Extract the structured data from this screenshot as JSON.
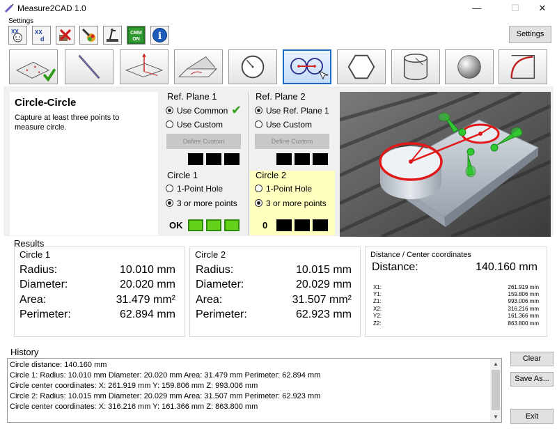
{
  "window": {
    "title": "Measure2CAD 1.0",
    "minimize": "—",
    "maximize": "☐",
    "close": "✕"
  },
  "toolbar": {
    "group_label": "Settings",
    "settings_button": "Settings",
    "cmm_label_top": "CMM",
    "cmm_label_bottom": "ON",
    "info_glyph": "i"
  },
  "description": {
    "title": "Circle-Circle",
    "text": "Capture at least three points to measure circle."
  },
  "ref_plane_1": {
    "title": "Ref. Plane 1",
    "options": [
      "Use Common",
      "Use Custom"
    ],
    "selected": 0,
    "define_label": "Define Custom",
    "status_check": "✔"
  },
  "ref_plane_2": {
    "title": "Ref. Plane 2",
    "options": [
      "Use Ref. Plane 1",
      "Use Custom"
    ],
    "selected": 0,
    "define_label": "Define Custom"
  },
  "circle_1": {
    "title": "Circle 1",
    "options": [
      "1-Point Hole",
      "3 or more points"
    ],
    "selected": 1,
    "status": "OK",
    "indicator_color": "#64d21a"
  },
  "circle_2": {
    "title": "Circle 2",
    "options": [
      "1-Point Hole",
      "3 or more points"
    ],
    "selected": 1,
    "status": "0",
    "highlight_color": "#ffffc0"
  },
  "results": {
    "label": "Results",
    "circle1": {
      "title": "Circle 1",
      "rows": [
        {
          "label": "Radius:",
          "value": "10.010 mm"
        },
        {
          "label": "Diameter:",
          "value": "20.020 mm"
        },
        {
          "label": "Area:",
          "value": "31.479 mm²"
        },
        {
          "label": "Perimeter:",
          "value": "62.894 mm"
        }
      ]
    },
    "circle2": {
      "title": "Circle 2",
      "rows": [
        {
          "label": "Radius:",
          "value": "10.015 mm"
        },
        {
          "label": "Diameter:",
          "value": "20.029 mm"
        },
        {
          "label": "Area:",
          "value": "31.507 mm²"
        },
        {
          "label": "Perimeter:",
          "value": "62.923 mm"
        }
      ]
    },
    "distance": {
      "title": "Distance / Center coordinates",
      "label": "Distance:",
      "value": "140.160 mm",
      "coords": [
        {
          "label": "X1:",
          "value": "261.919 mm"
        },
        {
          "label": "Y1:",
          "value": "159.806 mm"
        },
        {
          "label": "Z1:",
          "value": "993.006 mm"
        },
        {
          "label": "X2:",
          "value": "316.216 mm"
        },
        {
          "label": "Y2:",
          "value": "161.366 mm"
        },
        {
          "label": "Z2:",
          "value": "863.800 mm"
        }
      ]
    }
  },
  "history": {
    "label": "History",
    "lines": [
      "Circle distance: 140.160 mm",
      "Circle 1: Radius: 10.010 mm Diameter: 20.020 mm Area: 31.479 mm Perimeter: 62.894 mm",
      "Circle center coordinates: X: 261.919 mm Y: 159.806 mm Z: 993.006 mm",
      "Circle 2: Radius: 10.015 mm Diameter: 20.029 mm Area: 31.507 mm Perimeter: 62.923 mm",
      "Circle center coordinates: X: 316.216 mm Y: 161.366 mm Z: 863.800 mm"
    ],
    "clear_button": "Clear",
    "save_button": "Save As...",
    "exit_button": "Exit"
  },
  "colors": {
    "accent": "#1e69c8",
    "ok_green": "#64d21a",
    "measure_red": "#e02020"
  }
}
